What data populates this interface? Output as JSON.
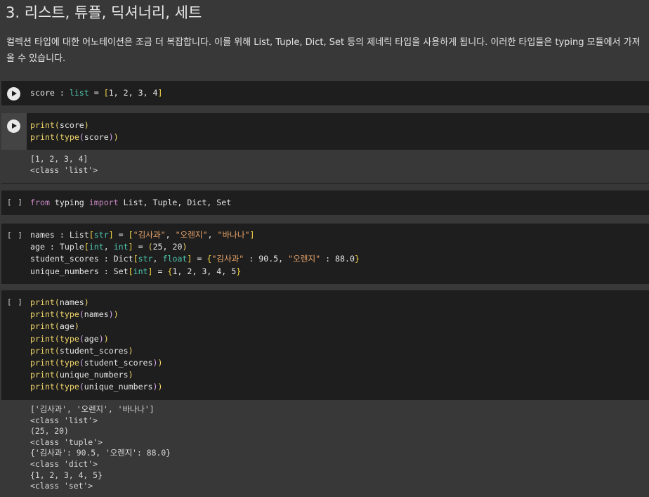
{
  "section": {
    "heading": "3. 리스트, 튜플, 딕셔너리, 세트",
    "paragraph_line1": "컬렉션 타입에 대한 어노테이션은 조금 더 복잡합니다. 이를 위해 List, Tuple, Dict, Set 등의 제네릭 타입을 사용하게 됩니다. 이러한 타입들은 typing 모듈에서 가져",
    "paragraph_line2": "올 수 있습니다."
  },
  "cells": [
    {
      "state": "run",
      "code": "score : list = [1, 2, 3, 4]"
    },
    {
      "state": "run",
      "code": "print(score)\nprint(type(score))",
      "output": "[1, 2, 3, 4]\n<class 'list'>"
    },
    {
      "state": "idle",
      "bracket": "[ ]",
      "code": "from typing import List, Tuple, Dict, Set"
    },
    {
      "state": "idle",
      "bracket": "[ ]",
      "code": "names : List[str] = [\"김사과\", \"오렌지\", \"바나나\"]\nage : Tuple[int, int] = (25, 20)\nstudent_scores : Dict[str, float] = {\"김사과\" : 90.5, \"오렌지\" : 88.0}\nunique_numbers : Set[int] = {1, 2, 3, 4, 5}"
    },
    {
      "state": "idle",
      "bracket": "[ ]",
      "code": "print(names)\nprint(type(names))\nprint(age)\nprint(type(age))\nprint(student_scores)\nprint(type(student_scores))\nprint(unique_numbers)\nprint(type(unique_numbers))",
      "output": "['김사과', '오렌지', '바나나']\n<class 'list'>\n(25, 20)\n<class 'tuple'>\n{'김사과': 90.5, '오렌지': 88.0}\n<class 'dict'>\n{1, 2, 3, 4, 5}\n<class 'set'>"
    }
  ],
  "colors": {
    "keyword": "#c586c0",
    "builtin_function": "#f2d76a",
    "type_name": "#4ec9b0",
    "string": "#e9a46a",
    "bracket": "#f5d547",
    "cell_background": "#1e1e1e",
    "page_background": "#383838"
  },
  "icons": {
    "run": "play-circle-icon"
  }
}
